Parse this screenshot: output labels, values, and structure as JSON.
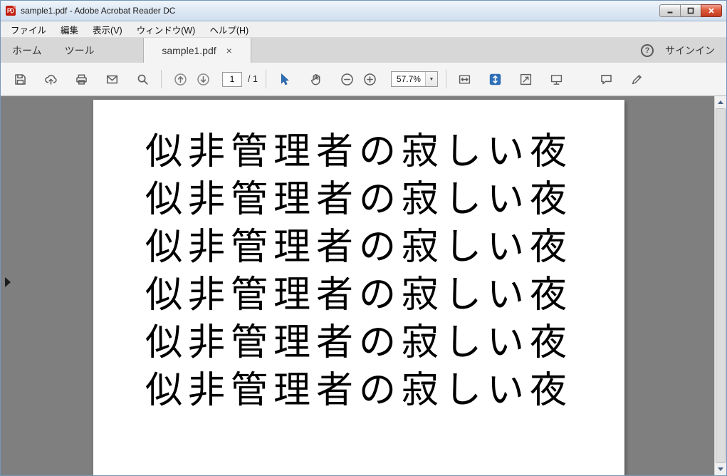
{
  "colors": {
    "accent_blue": "#2f6fb7",
    "doc_background": "#7f7f7f",
    "close_button_red": "#c23a20",
    "titlebar_blue": "#cfdeee"
  },
  "window": {
    "title": "sample1.pdf - Adobe Acrobat Reader DC"
  },
  "menubar": {
    "items": [
      "ファイル",
      "編集",
      "表示(V)",
      "ウィンドウ(W)",
      "ヘルプ(H)"
    ]
  },
  "tabbar": {
    "home_label": "ホーム",
    "tools_label": "ツール",
    "document_tab_label": "sample1.pdf",
    "tab_close_glyph": "×",
    "help_glyph": "?",
    "signin_label": "サインイン"
  },
  "toolbar": {
    "page_current": "1",
    "page_total_label": "/ 1",
    "zoom_value": "57.7%",
    "zoom_caret_glyph": "▼"
  },
  "document": {
    "lines": [
      "似非管理者の寂しい夜",
      "似非管理者の寂しい夜",
      "似非管理者の寂しい夜",
      "似非管理者の寂しい夜",
      "似非管理者の寂しい夜",
      "似非管理者の寂しい夜"
    ]
  }
}
